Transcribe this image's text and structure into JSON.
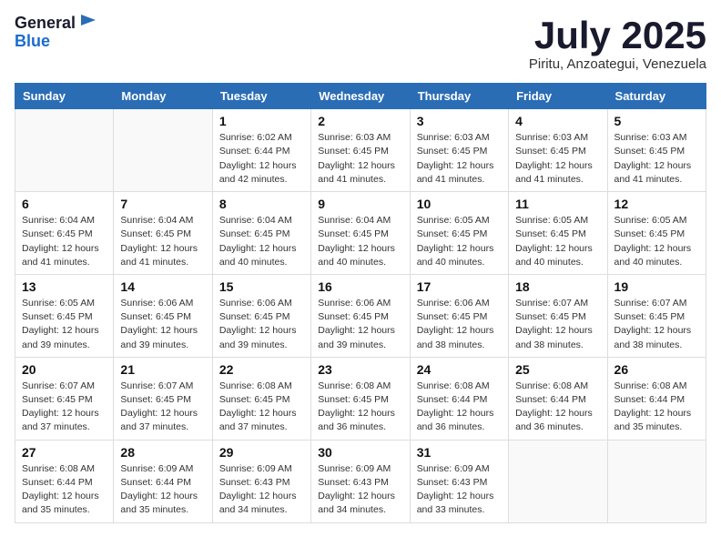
{
  "header": {
    "logo_line1": "General",
    "logo_line2": "Blue",
    "month": "July 2025",
    "location": "Piritu, Anzoategui, Venezuela"
  },
  "weekdays": [
    "Sunday",
    "Monday",
    "Tuesday",
    "Wednesday",
    "Thursday",
    "Friday",
    "Saturday"
  ],
  "weeks": [
    [
      {
        "day": "",
        "sunrise": "",
        "sunset": "",
        "daylight": ""
      },
      {
        "day": "",
        "sunrise": "",
        "sunset": "",
        "daylight": ""
      },
      {
        "day": "1",
        "sunrise": "Sunrise: 6:02 AM",
        "sunset": "Sunset: 6:44 PM",
        "daylight": "Daylight: 12 hours and 42 minutes."
      },
      {
        "day": "2",
        "sunrise": "Sunrise: 6:03 AM",
        "sunset": "Sunset: 6:45 PM",
        "daylight": "Daylight: 12 hours and 41 minutes."
      },
      {
        "day": "3",
        "sunrise": "Sunrise: 6:03 AM",
        "sunset": "Sunset: 6:45 PM",
        "daylight": "Daylight: 12 hours and 41 minutes."
      },
      {
        "day": "4",
        "sunrise": "Sunrise: 6:03 AM",
        "sunset": "Sunset: 6:45 PM",
        "daylight": "Daylight: 12 hours and 41 minutes."
      },
      {
        "day": "5",
        "sunrise": "Sunrise: 6:03 AM",
        "sunset": "Sunset: 6:45 PM",
        "daylight": "Daylight: 12 hours and 41 minutes."
      }
    ],
    [
      {
        "day": "6",
        "sunrise": "Sunrise: 6:04 AM",
        "sunset": "Sunset: 6:45 PM",
        "daylight": "Daylight: 12 hours and 41 minutes."
      },
      {
        "day": "7",
        "sunrise": "Sunrise: 6:04 AM",
        "sunset": "Sunset: 6:45 PM",
        "daylight": "Daylight: 12 hours and 41 minutes."
      },
      {
        "day": "8",
        "sunrise": "Sunrise: 6:04 AM",
        "sunset": "Sunset: 6:45 PM",
        "daylight": "Daylight: 12 hours and 40 minutes."
      },
      {
        "day": "9",
        "sunrise": "Sunrise: 6:04 AM",
        "sunset": "Sunset: 6:45 PM",
        "daylight": "Daylight: 12 hours and 40 minutes."
      },
      {
        "day": "10",
        "sunrise": "Sunrise: 6:05 AM",
        "sunset": "Sunset: 6:45 PM",
        "daylight": "Daylight: 12 hours and 40 minutes."
      },
      {
        "day": "11",
        "sunrise": "Sunrise: 6:05 AM",
        "sunset": "Sunset: 6:45 PM",
        "daylight": "Daylight: 12 hours and 40 minutes."
      },
      {
        "day": "12",
        "sunrise": "Sunrise: 6:05 AM",
        "sunset": "Sunset: 6:45 PM",
        "daylight": "Daylight: 12 hours and 40 minutes."
      }
    ],
    [
      {
        "day": "13",
        "sunrise": "Sunrise: 6:05 AM",
        "sunset": "Sunset: 6:45 PM",
        "daylight": "Daylight: 12 hours and 39 minutes."
      },
      {
        "day": "14",
        "sunrise": "Sunrise: 6:06 AM",
        "sunset": "Sunset: 6:45 PM",
        "daylight": "Daylight: 12 hours and 39 minutes."
      },
      {
        "day": "15",
        "sunrise": "Sunrise: 6:06 AM",
        "sunset": "Sunset: 6:45 PM",
        "daylight": "Daylight: 12 hours and 39 minutes."
      },
      {
        "day": "16",
        "sunrise": "Sunrise: 6:06 AM",
        "sunset": "Sunset: 6:45 PM",
        "daylight": "Daylight: 12 hours and 39 minutes."
      },
      {
        "day": "17",
        "sunrise": "Sunrise: 6:06 AM",
        "sunset": "Sunset: 6:45 PM",
        "daylight": "Daylight: 12 hours and 38 minutes."
      },
      {
        "day": "18",
        "sunrise": "Sunrise: 6:07 AM",
        "sunset": "Sunset: 6:45 PM",
        "daylight": "Daylight: 12 hours and 38 minutes."
      },
      {
        "day": "19",
        "sunrise": "Sunrise: 6:07 AM",
        "sunset": "Sunset: 6:45 PM",
        "daylight": "Daylight: 12 hours and 38 minutes."
      }
    ],
    [
      {
        "day": "20",
        "sunrise": "Sunrise: 6:07 AM",
        "sunset": "Sunset: 6:45 PM",
        "daylight": "Daylight: 12 hours and 37 minutes."
      },
      {
        "day": "21",
        "sunrise": "Sunrise: 6:07 AM",
        "sunset": "Sunset: 6:45 PM",
        "daylight": "Daylight: 12 hours and 37 minutes."
      },
      {
        "day": "22",
        "sunrise": "Sunrise: 6:08 AM",
        "sunset": "Sunset: 6:45 PM",
        "daylight": "Daylight: 12 hours and 37 minutes."
      },
      {
        "day": "23",
        "sunrise": "Sunrise: 6:08 AM",
        "sunset": "Sunset: 6:45 PM",
        "daylight": "Daylight: 12 hours and 36 minutes."
      },
      {
        "day": "24",
        "sunrise": "Sunrise: 6:08 AM",
        "sunset": "Sunset: 6:44 PM",
        "daylight": "Daylight: 12 hours and 36 minutes."
      },
      {
        "day": "25",
        "sunrise": "Sunrise: 6:08 AM",
        "sunset": "Sunset: 6:44 PM",
        "daylight": "Daylight: 12 hours and 36 minutes."
      },
      {
        "day": "26",
        "sunrise": "Sunrise: 6:08 AM",
        "sunset": "Sunset: 6:44 PM",
        "daylight": "Daylight: 12 hours and 35 minutes."
      }
    ],
    [
      {
        "day": "27",
        "sunrise": "Sunrise: 6:08 AM",
        "sunset": "Sunset: 6:44 PM",
        "daylight": "Daylight: 12 hours and 35 minutes."
      },
      {
        "day": "28",
        "sunrise": "Sunrise: 6:09 AM",
        "sunset": "Sunset: 6:44 PM",
        "daylight": "Daylight: 12 hours and 35 minutes."
      },
      {
        "day": "29",
        "sunrise": "Sunrise: 6:09 AM",
        "sunset": "Sunset: 6:43 PM",
        "daylight": "Daylight: 12 hours and 34 minutes."
      },
      {
        "day": "30",
        "sunrise": "Sunrise: 6:09 AM",
        "sunset": "Sunset: 6:43 PM",
        "daylight": "Daylight: 12 hours and 34 minutes."
      },
      {
        "day": "31",
        "sunrise": "Sunrise: 6:09 AM",
        "sunset": "Sunset: 6:43 PM",
        "daylight": "Daylight: 12 hours and 33 minutes."
      },
      {
        "day": "",
        "sunrise": "",
        "sunset": "",
        "daylight": ""
      },
      {
        "day": "",
        "sunrise": "",
        "sunset": "",
        "daylight": ""
      }
    ]
  ]
}
